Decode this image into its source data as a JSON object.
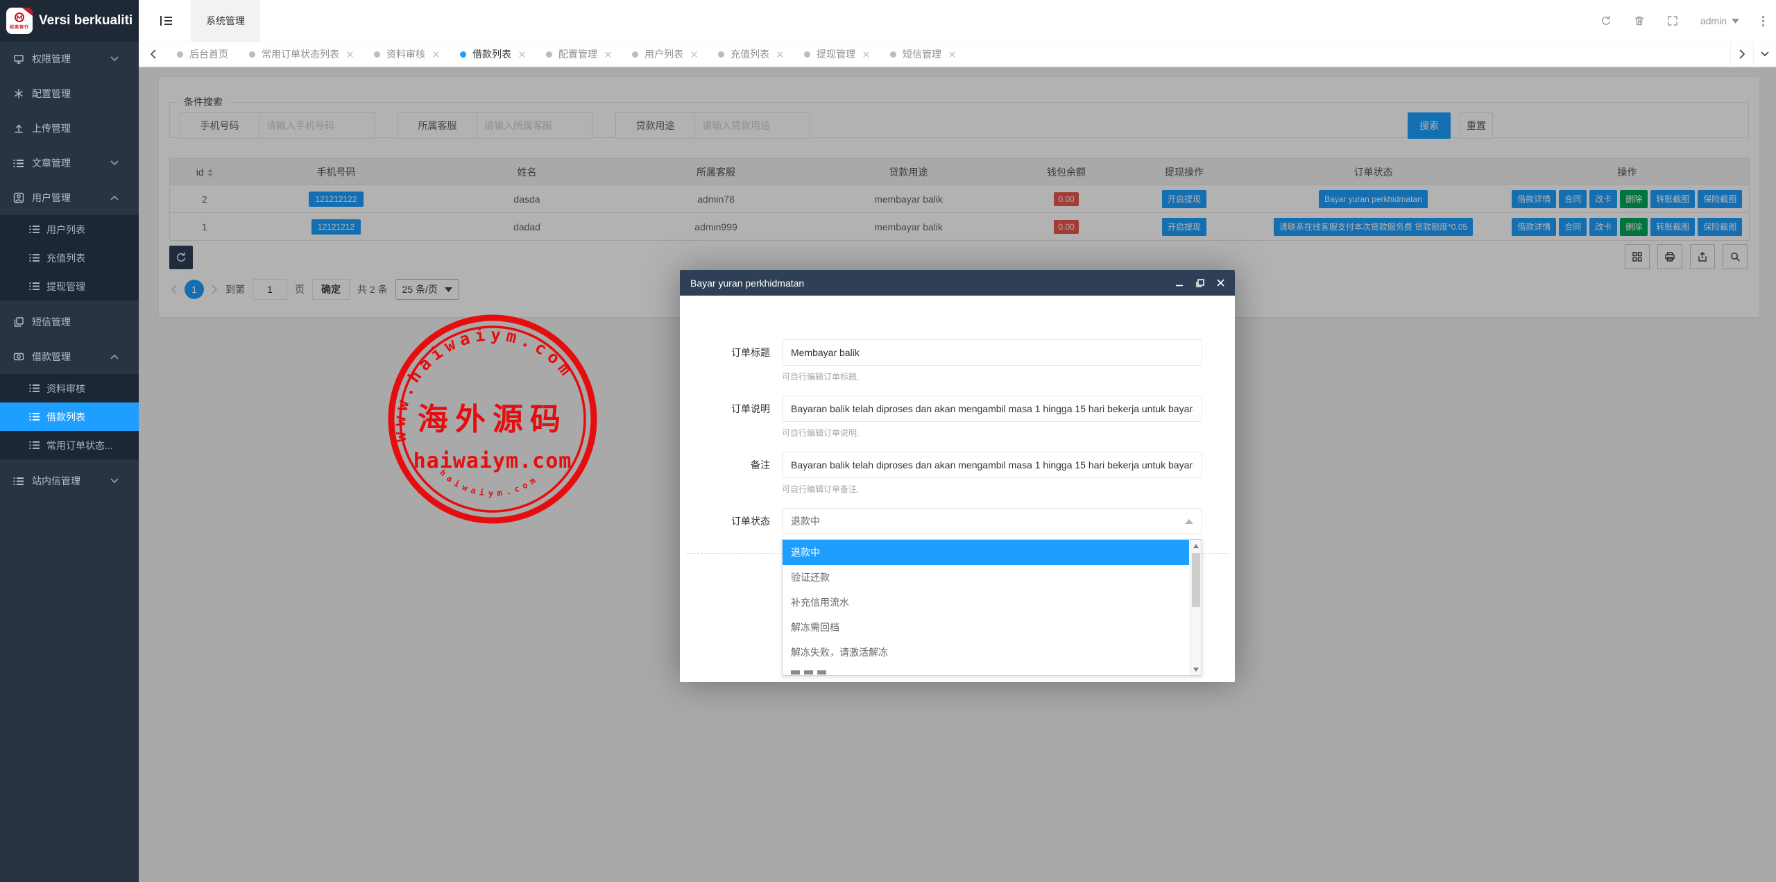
{
  "app": {
    "brand": "Versi berkualiti",
    "logo_caption": "招商银行"
  },
  "colors": {
    "accent": "#1E9FFF",
    "sidebar": "#293442",
    "modal_header": "#2f4056",
    "danger": "#e8564e",
    "green": "#00a65a",
    "stamp_red": "#e50d0d"
  },
  "header": {
    "nav_tab": "系统管理",
    "user": "admin"
  },
  "sidebar": {
    "items": [
      {
        "label": "权限管理",
        "icon": "monitor-icon",
        "chevron": "down"
      },
      {
        "label": "配置管理",
        "icon": "gear-icon"
      },
      {
        "label": "上传管理",
        "icon": "upload-icon"
      },
      {
        "label": "文章管理",
        "icon": "list-icon",
        "chevron": "down"
      },
      {
        "label": "用户管理",
        "icon": "user-icon",
        "chevron": "up",
        "children": [
          {
            "label": "用户列表"
          },
          {
            "label": "充值列表"
          },
          {
            "label": "提现管理"
          }
        ]
      },
      {
        "label": "短信管理",
        "icon": "copy-icon"
      },
      {
        "label": "借款管理",
        "icon": "money-icon",
        "chevron": "up",
        "children": [
          {
            "label": "资料审核"
          },
          {
            "label": "借款列表",
            "active": true
          },
          {
            "label": "常用订单状态..."
          }
        ]
      },
      {
        "label": "站内信管理",
        "icon": "list-icon",
        "chevron": "down"
      }
    ]
  },
  "tabbar": {
    "tabs": [
      {
        "label": "后台首页",
        "closable": false
      },
      {
        "label": "常用订单状态列表",
        "closable": true
      },
      {
        "label": "资料审核",
        "closable": true
      },
      {
        "label": "借款列表",
        "closable": true,
        "active": true
      },
      {
        "label": "配置管理",
        "closable": true
      },
      {
        "label": "用户列表",
        "closable": true
      },
      {
        "label": "充值列表",
        "closable": true
      },
      {
        "label": "提现管理",
        "closable": true
      },
      {
        "label": "短信管理",
        "closable": true
      }
    ]
  },
  "search": {
    "legend": "条件搜索",
    "fields": [
      {
        "label": "手机号码",
        "placeholder": "请输入手机号码"
      },
      {
        "label": "所属客服",
        "placeholder": "请输入所属客服"
      },
      {
        "label": "贷款用途",
        "placeholder": "请输入贷款用途"
      }
    ],
    "search_label": "搜索",
    "reset_label": "重置"
  },
  "table": {
    "columns": [
      "id",
      "手机号码",
      "姓名",
      "所属客服",
      "贷款用途",
      "钱包余额",
      "提现操作",
      "订单状态",
      "操作"
    ],
    "rows": [
      {
        "id": "2",
        "phone": "121212122",
        "name": "dasda",
        "agent": "admin78",
        "purpose": "membayar balik",
        "balance": "0.00",
        "withdraw": "开启提现",
        "status": "Bayar yuran perkhidmatan",
        "actions": [
          {
            "label": "借款详情",
            "variant": "blue"
          },
          {
            "label": "合同",
            "variant": "blue"
          },
          {
            "label": "改卡",
            "variant": "blue"
          },
          {
            "label": "删除",
            "variant": "green"
          },
          {
            "label": "转账截图",
            "variant": "blue"
          },
          {
            "label": "保险截图",
            "variant": "blue"
          }
        ]
      },
      {
        "id": "1",
        "phone": "12121212",
        "name": "dadad",
        "agent": "admin999",
        "purpose": "membayar balik",
        "balance": "0.00",
        "withdraw": "开启提现",
        "status": "请联系在线客服支付本次贷款服务费 贷款额度*0.05",
        "actions": [
          {
            "label": "借款详情",
            "variant": "blue"
          },
          {
            "label": "合同",
            "variant": "blue"
          },
          {
            "label": "改卡",
            "variant": "blue"
          },
          {
            "label": "删除",
            "variant": "green"
          },
          {
            "label": "转账截图",
            "variant": "blue"
          },
          {
            "label": "保险截图",
            "variant": "blue"
          }
        ]
      }
    ]
  },
  "pagination": {
    "current": "1",
    "goto_prefix": "到第",
    "goto_value": "1",
    "goto_suffix": "页",
    "confirm_label": "确定",
    "total_label": "共 2 条",
    "page_size_label": "25 条/页"
  },
  "modal": {
    "title": "Bayar yuran perkhidmatan",
    "fields": [
      {
        "label": "订单标题",
        "value": "Membayar balik",
        "help": "可自行编辑订单标题,"
      },
      {
        "label": "订单说明",
        "value": "Bayaran balik telah diproses dan akan mengambil masa 1 hingga 15 hari bekerja untuk bayaran",
        "help": "可自行编辑订单说明,"
      },
      {
        "label": "备注",
        "value": "Bayaran balik telah diproses dan akan mengambil masa 1 hingga 15 hari bekerja untuk bayaran",
        "help": "可自行编辑订单备注,"
      }
    ],
    "status": {
      "label": "订单状态",
      "value": "退款中"
    },
    "dropdown": {
      "options": [
        "退款中",
        "验证还款",
        "补充信用流水",
        "解冻需回档",
        "解冻失败，请激活解冻"
      ],
      "selected_index": 0
    }
  },
  "watermark": {
    "top_text": "www.haiwaiym.com",
    "center_text": "海外源码",
    "main_text": "haiwaiym.com",
    "bottom_text": "haiwaiym.com"
  }
}
